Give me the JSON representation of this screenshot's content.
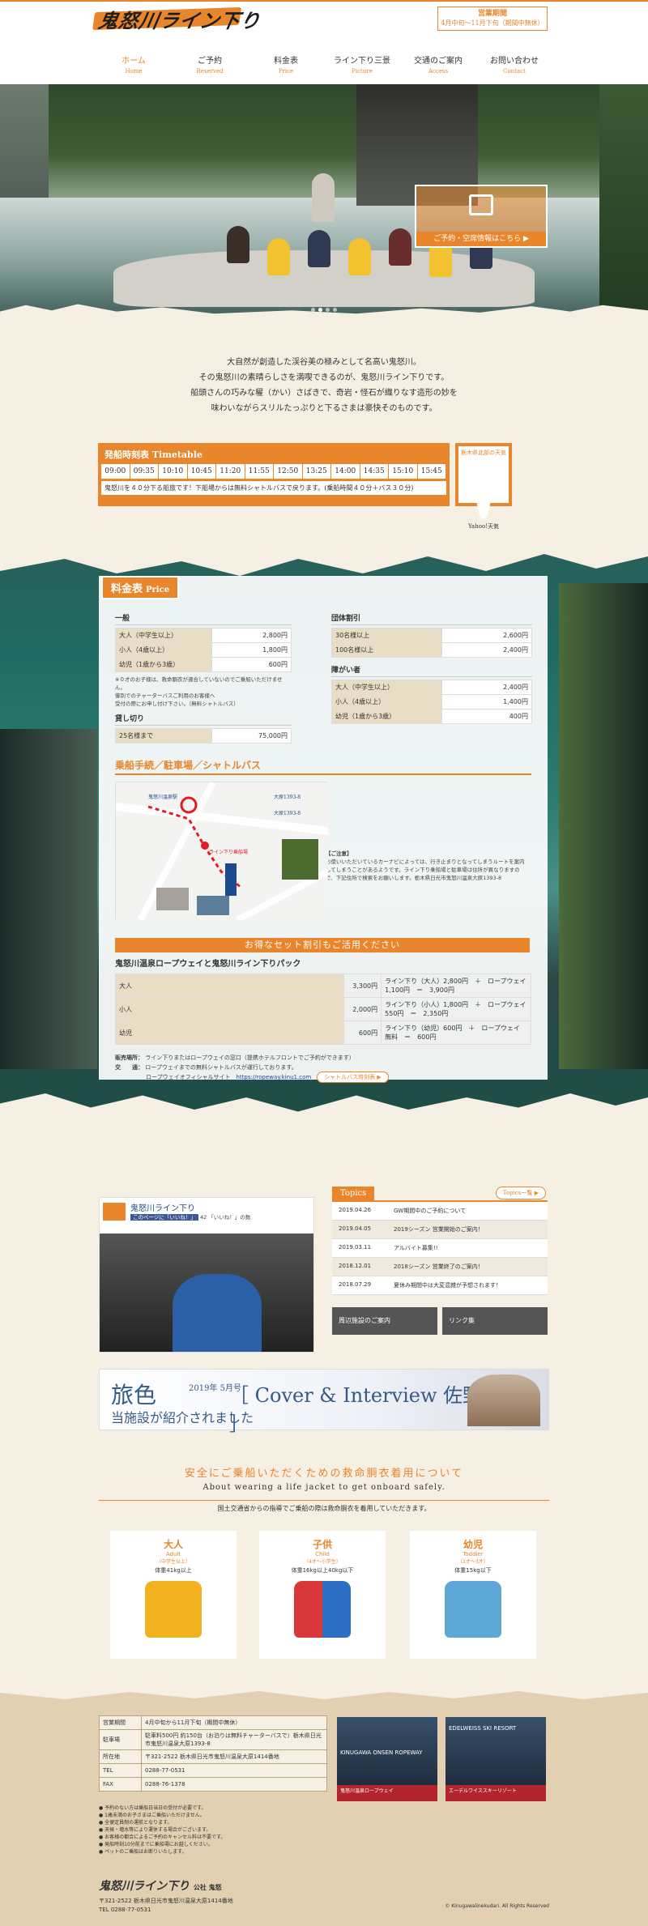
{
  "header": {
    "logo": "鬼怒川ライン下り",
    "hours_title": "営業期間",
    "hours_text": "4月中旬〜11月下旬（期間中無休）",
    "nav": [
      {
        "label": "ホーム",
        "en": "Home"
      },
      {
        "label": "ご予約",
        "en": "Reserved"
      },
      {
        "label": "料金表",
        "en": "Price"
      },
      {
        "label": "ライン下り三景",
        "en": "Picture"
      },
      {
        "label": "交通のご案内",
        "en": "Access"
      },
      {
        "label": "お問い合わせ",
        "en": "Contact"
      }
    ]
  },
  "hero": {
    "cta_label": "ご予約・空席情報はこちら ▶",
    "slides": 4,
    "active": 2
  },
  "intro": [
    "大自然が創造した渓谷美の極みとして名高い鬼怒川。",
    "その鬼怒川の素晴らしさを満喫できるのが、鬼怒川ライン下りです。",
    "船頭さんの巧みな櫂（かい）さばきで、奇岩・怪石が織りなす造形の妙を",
    "味わいながらスリルたっぷりと下るさまは豪快そのものです。"
  ],
  "timetable": {
    "title": "発船時刻表 Timetable",
    "times": [
      "09:00",
      "09:35",
      "10:10",
      "10:45",
      "11:20",
      "11:55",
      "12:50",
      "13:25",
      "14:00",
      "14:35",
      "15:10",
      "15:45"
    ],
    "note": "鬼怒川を４０分下る船旅です！下船場からは無料シャトルバスで戻ります。(乗船時間４０分＋バス３０分)"
  },
  "weather": {
    "title": "栃木県北部の天気",
    "brand": "Yahoo!天気"
  },
  "price": {
    "tab": "料金表",
    "tab_en": "Price",
    "general_title": "一般",
    "general": [
      {
        "k": "大人（中学生以上）",
        "v": "2,800円"
      },
      {
        "k": "小人（4歳以上）",
        "v": "1,800円"
      },
      {
        "k": "幼児（1歳から3歳）",
        "v": "600円"
      }
    ],
    "general_note1": "※０才のお子様は、救命胴衣が適合していないのでご乗船いただけません。",
    "general_note2": "御別でのチャーターバスご利用のお客様へ",
    "general_note3": "受付の際にお申し付け下さい。（無料シャトルバス）",
    "charter_title": "貸し切り",
    "charter": [
      {
        "k": "25名様まで",
        "v": "75,000円"
      }
    ],
    "group_title": "団体割引",
    "group": [
      {
        "k": "30名様以上",
        "v": "2,600円"
      },
      {
        "k": "100名様以上",
        "v": "2,400円"
      }
    ],
    "disabled_title": "障がい者",
    "disabled": [
      {
        "k": "大人（中学生以上）",
        "v": "2,400円"
      },
      {
        "k": "小人（4歳以上）",
        "v": "1,400円"
      },
      {
        "k": "幼児（1歳から3歳）",
        "v": "400円"
      }
    ]
  },
  "access": {
    "title": "乗船手続／駐車場／シャトルバス",
    "note_title": "【ご注意】",
    "note": "お使いいただいているカーナビによっては、行き止まりとなってしまうルートを案内してしまうことがあるようです。ライン下り乗船場と駐車場は住所が異なりますので、下記住所で検索をお願いします。栃木県日光市鬼怒川温泉大原1393-8",
    "map_labels": [
      "鬼怒川温泉駅",
      "ライン下り乗船場",
      "大原1393-8",
      "大原1393-8"
    ]
  },
  "setplan": {
    "bar": "お得なセット割引もご活用ください",
    "title": "鬼怒川温泉ロープウェイと鬼怒川ライン下りパック",
    "rows": [
      {
        "k": "大人",
        "price": "3,300円",
        "detail": "ライン下り（大人）2,800円　＋　ロープウェイ 1,100円　＝　3,900円"
      },
      {
        "k": "小人",
        "price": "2,000円",
        "detail": "ライン下り（小人）1,800円　＋　ロープウェイ　550円　＝　2,350円"
      },
      {
        "k": "幼児",
        "price": "600円",
        "detail": "ライン下り（幼児）600円　＋　ロープウェイ　無料　＝　600円"
      }
    ],
    "sales_label": "販売場所：",
    "sales_text": "ライン下りまたはロープウェイの窓口（提携ホテルフロントでご予約ができます）",
    "traffic_label": "交　　通：",
    "traffic_text1": "ロープウェイまでの無料シャトルバスが運行しております。",
    "traffic_text2": "ロープウェイオフィシャルサイト",
    "traffic_link": "https://ropeway.kinu1.com",
    "bus_btn": "シャトルバス時刻表 ▶"
  },
  "facebook": {
    "page": "鬼怒川ライン下り",
    "like": "このページに「いいね！」",
    "count": "42 「いいね！」の数"
  },
  "topics": {
    "title": "Topics",
    "more": "Topics一覧 ▶",
    "items": [
      {
        "date": "2019.04.26",
        "text": "GW期間中のご予約について"
      },
      {
        "date": "2019.04.05",
        "text": "2019シーズン 営業開始のご案内！"
      },
      {
        "date": "2019.03.11",
        "text": "アルバイト募集!!"
      },
      {
        "date": "2018.12.01",
        "text": "2018シーズン 営業終了のご案内！"
      },
      {
        "date": "2018.07.29",
        "text": "夏休み期間中は大変混雑が予想されます！"
      }
    ],
    "btn1": "周辺施設のご案内",
    "btn2": "リンク集"
  },
  "banner": {
    "t1": "旅色",
    "t2": "当施設が紹介されました",
    "t3": "2019年 5月号",
    "t4": "［ Cover & Interview 佐野ひなこ ］"
  },
  "lifejacket": {
    "title": "安全にご乗船いただくための救命胴衣着用について",
    "sub": "About wearing a life jacket to get onboard safely.",
    "desc": "国土交通省からの指導でご乗船の際は救命胴衣を着用していただきます。",
    "items": [
      {
        "name": "大人",
        "en": "Adult",
        "sub": "（中学生以上）",
        "weight": "体重41kg以上",
        "color": "#f2b21f"
      },
      {
        "name": "子供",
        "en": "Child",
        "sub": "（4才〜小学生）",
        "weight": "体重16kg以上40kg以下",
        "color": "#d8383a"
      },
      {
        "name": "幼児",
        "en": "Toddler",
        "sub": "（1才〜3才）",
        "weight": "体重15kg以下",
        "color": "#5ea8d8"
      }
    ]
  },
  "footer": {
    "rows": [
      {
        "k": "営業期間",
        "v": "4月中旬から11月下旬（期間中無休）"
      },
      {
        "k": "駐車場",
        "v": "駐車料500円 約150台（お泊りは無料チャーターバスで）栃木県日光市鬼怒川温泉大原1393-8"
      },
      {
        "k": "所在地",
        "v": "〒321-2522 栃木県日光市鬼怒川温泉大原1414番地"
      },
      {
        "k": "TEL",
        "v": "0288-77-0531"
      },
      {
        "k": "FAX",
        "v": "0288-76-1378"
      }
    ],
    "notes": [
      "● 予約のない方は乗船日当日の受付が必要です。",
      "● 1歳未満のお子さまはご乗船いただけません。",
      "● 全便定員制の運航となります。",
      "● 天候・増水等により運休する場合がございます。",
      "● お客様の都合によるご予約のキャンセル料は不要です。",
      "● 発船時刻10分前までに乗船場にお越しください。",
      "● ペットのご乗船はお断りいたします。"
    ],
    "ban1_title": "KINUGAWA ONSEN ROPEWAY",
    "ban1_cap": "鬼怒川温泉ロープウェイ",
    "ban2_title": "EDELWEISS SKI RESORT",
    "ban2_cap": "エーデルワイススキーリゾート",
    "logo": "鬼怒川ライン下り",
    "company": "公社 鬼怒",
    "addr": "〒321-2522 栃木県日光市鬼怒川温泉大原1414番地",
    "tel": "TEL 0288-77-0531",
    "copyright": "© Kinugawalinekudari. All Rights Reserved"
  }
}
